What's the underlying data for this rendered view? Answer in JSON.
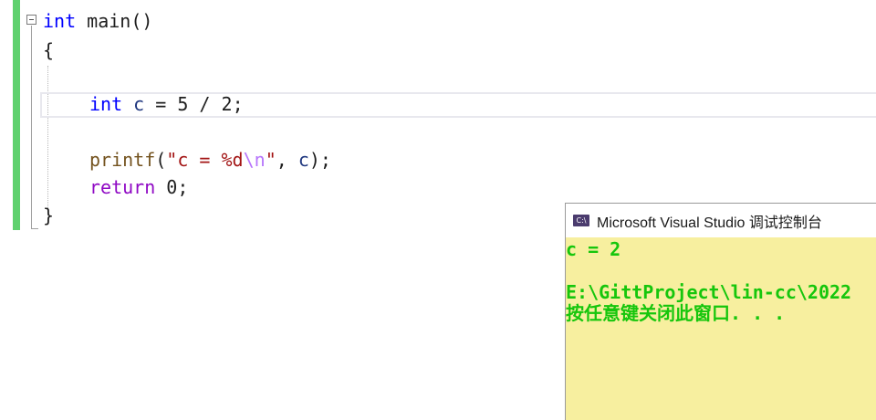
{
  "editor": {
    "lines": {
      "l1": {
        "kw": "int",
        "rest": " main()"
      },
      "l2": "{",
      "l4": {
        "kw": "int",
        "var1": "c",
        "op": " = ",
        "n1": "5",
        "slash": " / ",
        "n2": "2",
        "semi": ";"
      },
      "l6": {
        "fn": "printf",
        "open": "(",
        "str1": "\"c = %d",
        "esc": "\\n",
        "str2": "\"",
        "comma": ", ",
        "var": "c",
        "close": ");"
      },
      "l7": {
        "kw": "return",
        "sp": " ",
        "num": "0",
        "semi": ";"
      },
      "l8": "}"
    }
  },
  "console": {
    "title": "Microsoft Visual Studio 调试控制台",
    "icon_text": "C:\\",
    "output": [
      "c = 2",
      "",
      "E:\\GittProject\\lin-cc\\2022",
      "按任意键关闭此窗口. . ."
    ]
  }
}
